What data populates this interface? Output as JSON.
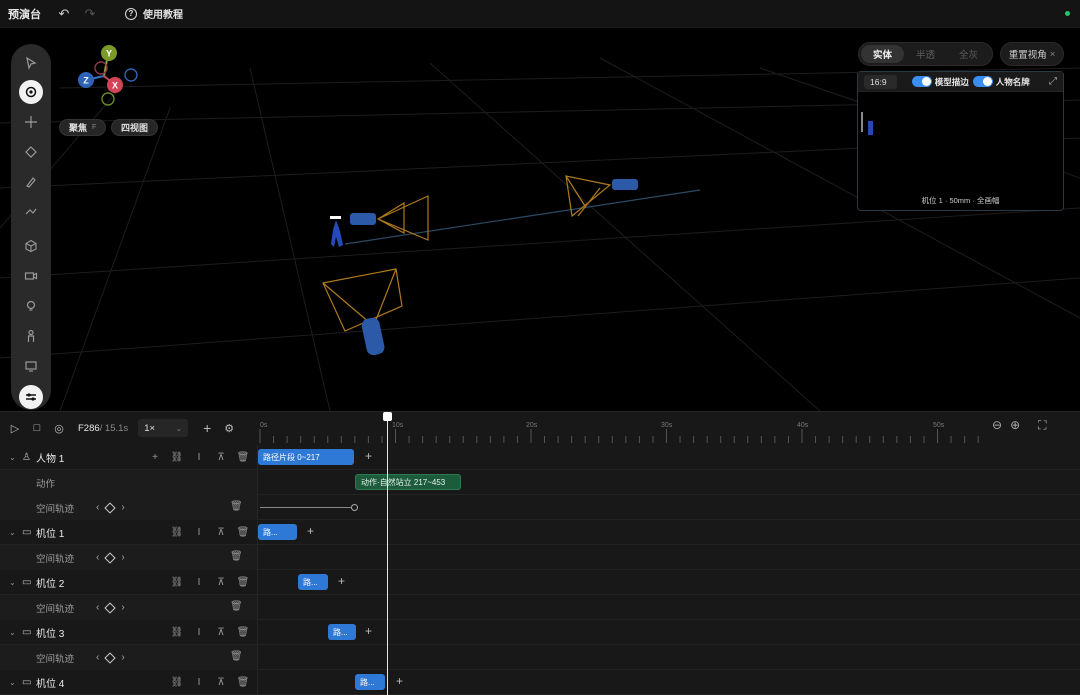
{
  "topbar": {
    "title": "预演台",
    "undo_icon": "undo-icon",
    "redo_icon": "redo-icon",
    "help_label": "使用教程"
  },
  "viewport": {
    "focus_label": "聚焦",
    "focus_key": "F",
    "four_view_label": "四视图",
    "modes": [
      "实体",
      "半透",
      "全灰"
    ],
    "active_mode": "实体",
    "reset_label": "重置视角",
    "axis": {
      "y": "Y",
      "z": "Z",
      "x": "X"
    },
    "tools": [
      "select-icon",
      "orbit-icon",
      "move-icon",
      "rotate-icon",
      "pen-icon",
      "path-icon",
      "cube-icon",
      "camera-icon",
      "light-icon",
      "person-icon",
      "screen-icon",
      "settings-icon"
    ],
    "active_tool": "orbit-icon"
  },
  "preview": {
    "ratio": "16:9",
    "toggle1_label": "模型描边",
    "toggle2_label": "人物名牌",
    "caption": "机位 1 · 50mm · 全画幅"
  },
  "timeline": {
    "frame": "F286",
    "duration": "/ 15.1s",
    "speed": "1×",
    "ruler": [
      "0s",
      "10s",
      "20s",
      "30s",
      "40s",
      "50s"
    ],
    "rows": [
      {
        "type": "track",
        "name": "人物 1",
        "icon": "person-icon"
      },
      {
        "type": "sub",
        "name": "动作"
      },
      {
        "type": "sub",
        "name": "空间轨迹"
      },
      {
        "type": "track",
        "name": "机位 1",
        "icon": "camera-icon"
      },
      {
        "type": "sub",
        "name": "空间轨迹"
      },
      {
        "type": "track",
        "name": "机位 2",
        "icon": "camera-icon"
      },
      {
        "type": "sub",
        "name": "空间轨迹"
      },
      {
        "type": "track",
        "name": "机位 3",
        "icon": "camera-icon"
      },
      {
        "type": "sub",
        "name": "空间轨迹"
      },
      {
        "type": "track",
        "name": "机位 4",
        "icon": "camera-icon"
      }
    ],
    "clips": {
      "path_clip": "路径片段 0~217",
      "action_clip": "动作·自然站立 217~453",
      "short_clip": "路..."
    }
  }
}
